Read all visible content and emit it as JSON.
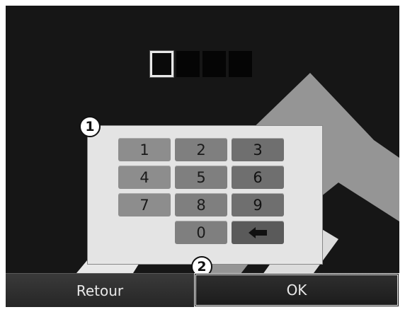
{
  "pin": {
    "slots": 4,
    "active_slot": 1
  },
  "keypad": {
    "keys": [
      "1",
      "2",
      "3",
      "4",
      "5",
      "6",
      "7",
      "8",
      "9",
      "",
      "0",
      "backspace"
    ],
    "backspace_icon": "backspace-arrow-icon"
  },
  "callouts": {
    "keypad_marker": "1",
    "ok_marker": "2"
  },
  "buttons": {
    "back_label": "Retour",
    "ok_label": "OK"
  },
  "colors": {
    "screen_bg": "#161616",
    "key_bg": "#8d8d8d",
    "panel_bg": "#e4e4e4"
  }
}
